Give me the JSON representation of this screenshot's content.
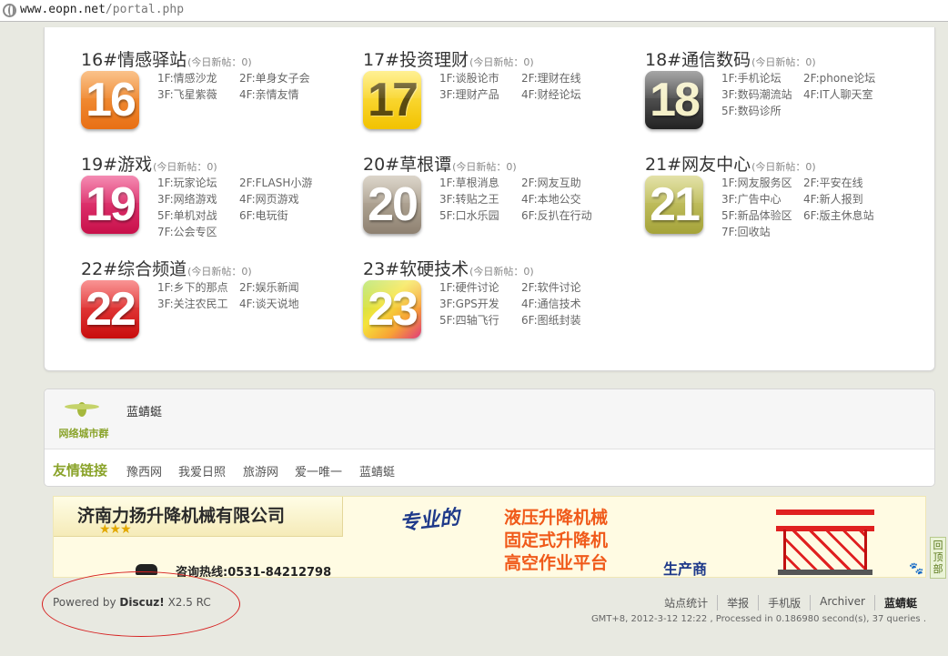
{
  "address_bar": {
    "url_domain": "www.eopn.net",
    "url_path": "/portal.php"
  },
  "forums": [
    {
      "title": "16#情感驿站",
      "today": "(今日新帖：0)",
      "number": "16",
      "color": "#e86f14",
      "subs": [
        "1F:情感沙龙",
        "2F:单身女子会",
        "3F:飞星紫薇",
        "4F:亲情友情"
      ]
    },
    {
      "title": "17#投资理财",
      "today": "(今日新帖：0)",
      "number": "17",
      "color": "#f2c200",
      "subs": [
        "1F:谈股论市",
        "2F:理财在线",
        "3F:理财产品",
        "4F:财经论坛"
      ]
    },
    {
      "title": "18#通信数码",
      "today": "(今日新帖：0)",
      "number": "18",
      "color": "#333333",
      "subs": [
        "1F:手机论坛",
        "2F:phone论坛",
        "3F:数码潮流站",
        "4F:IT人聊天室",
        "5F:数码诊所"
      ]
    },
    {
      "title": "19#游戏",
      "today": "(今日新帖：0)",
      "number": "19",
      "color": "#c8104a",
      "subs": [
        "1F:玩家论坛",
        "2F:FLASH小游",
        "3F:网络游戏",
        "4F:网页游戏",
        "5F:单机对战",
        "6F:电玩街",
        "7F:公会专区"
      ]
    },
    {
      "title": "20#草根谭",
      "today": "(今日新帖：0)",
      "number": "20",
      "color": "#8e8171",
      "subs": [
        "1F:草根消息",
        "2F:网友互助",
        "3F:转贴之王",
        "4F:本地公交",
        "5F:口水乐园",
        "6F:反扒在行动"
      ]
    },
    {
      "title": "21#网友中心",
      "today": "(今日新帖：0)",
      "number": "21",
      "color": "#a5a339",
      "subs": [
        "1F:网友服务区",
        "2F:平安在线",
        "3F:广告中心",
        "4F:新人报到",
        "5F:新品体验区",
        "6F:版主休息站",
        "7F:回收站"
      ]
    },
    {
      "title": "22#综合频道",
      "today": "(今日新帖：0)",
      "number": "22",
      "color": "#c80c0c",
      "subs": [
        "1F:乡下的那点",
        "2F:娱乐新闻",
        "3F:关注农民工",
        "4F:谈天说地"
      ]
    },
    {
      "title": "23#软硬技术",
      "today": "(今日新帖：0)",
      "number": "23",
      "color": "#f5e33a",
      "subs": [
        "1F:硬件讨论",
        "2F:软件讨论",
        "3F:GPS开发",
        "4F:通信技术",
        "5F:四轴飞行",
        "6F:图纸封装"
      ]
    }
  ],
  "links_section": {
    "logo_text": "网络城市群",
    "site_name": "蓝蜻蜓",
    "label": "友情链接",
    "friends": [
      "豫西网",
      "我爱日照",
      "旅游网",
      "爱一唯一",
      "蓝蜻蜓"
    ]
  },
  "banner": {
    "company": "济南力扬升降机械有限公司",
    "stars": "★★★",
    "phone": "咨询热线:0531-84212798",
    "tagline": "专业的",
    "products": [
      "液压升降机械",
      "固定式升降机",
      "高空作业平台"
    ],
    "maker": "生产商"
  },
  "back_to_top": "回顶部",
  "footer": {
    "powered_prefix": "Powered by",
    "powered_brand": "Discuz!",
    "powered_version": "X2.5 RC",
    "links": [
      "站点统计",
      "举报",
      "手机版",
      "Archiver",
      "蓝蜻蜓"
    ],
    "info": "GMT+8, 2012-3-12 12:22 , Processed in 0.186980 second(s), 37 queries ."
  }
}
